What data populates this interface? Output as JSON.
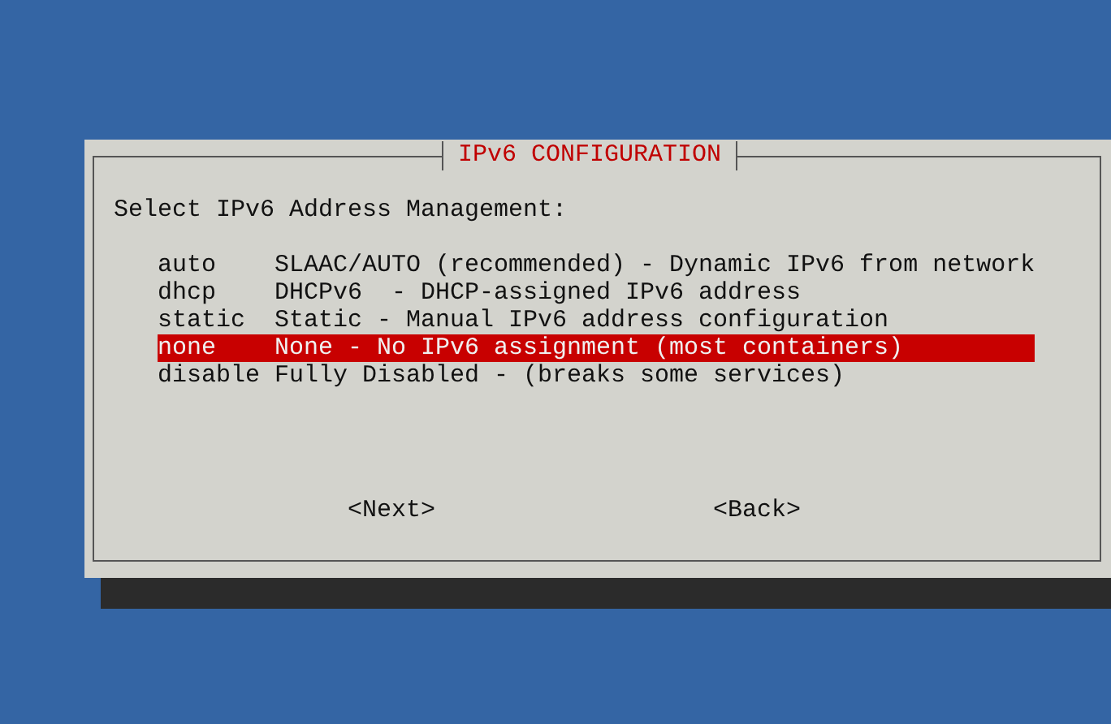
{
  "dialog": {
    "title": "IPv6 CONFIGURATION",
    "prompt": "Select IPv6 Address Management:",
    "options": [
      {
        "tag": "auto",
        "description": "SLAAC/AUTO (recommended) - Dynamic IPv6 from network",
        "selected": false
      },
      {
        "tag": "dhcp",
        "description": "DHCPv6  - DHCP-assigned IPv6 address",
        "selected": false
      },
      {
        "tag": "static",
        "description": "Static - Manual IPv6 address configuration",
        "selected": false
      },
      {
        "tag": "none",
        "description": "None - No IPv6 assignment (most containers)",
        "selected": true
      },
      {
        "tag": "disable",
        "description": "Fully Disabled - (breaks some services)",
        "selected": false
      }
    ],
    "buttons": [
      {
        "label": "<Next>",
        "selected": false
      },
      {
        "label": "<Back>",
        "selected": false
      }
    ]
  }
}
